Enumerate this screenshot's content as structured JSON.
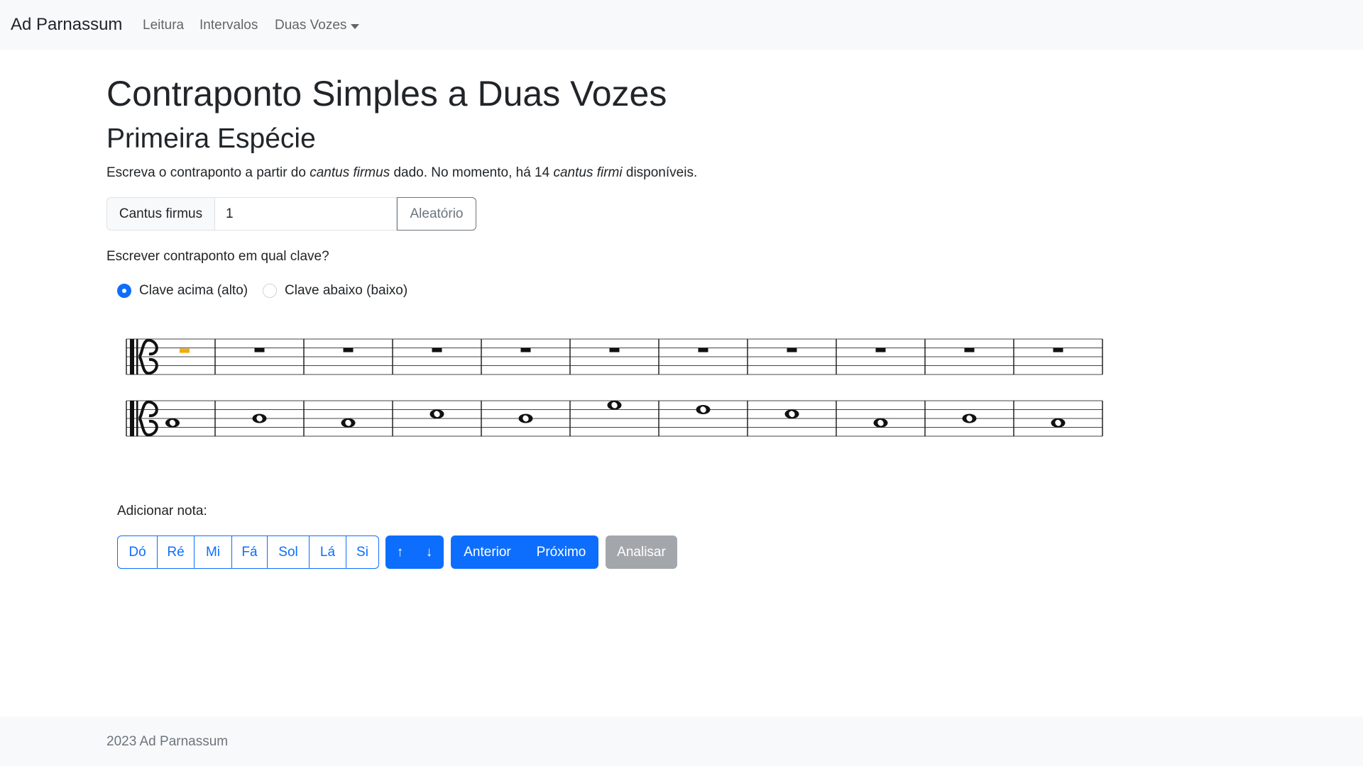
{
  "navbar": {
    "brand": "Ad Parnassum",
    "links": [
      "Leitura",
      "Intervalos",
      "Duas Vozes"
    ]
  },
  "page": {
    "title": "Contraponto Simples a Duas Vozes",
    "subtitle": "Primeira Espécie",
    "intro": {
      "part1": "Escreva o contraponto a partir do ",
      "em1": "cantus firmus",
      "part2": " dado. No momento, há 14 ",
      "em2": "cantus firmi",
      "part3": " disponíveis."
    }
  },
  "cantus_selector": {
    "label": "Cantus firmus",
    "value": "1",
    "random_button": "Aleatório"
  },
  "clef_question": "Escrever contraponto em qual clave?",
  "clef_options": [
    {
      "label": "Clave acima (alto)",
      "checked": true
    },
    {
      "label": "Clave abaixo (baixo)",
      "checked": false
    }
  ],
  "score": {
    "measures": 11,
    "upper_staff": {
      "clef": "alto",
      "content": "rests",
      "cursor_measure": 1,
      "cursor_color": "#f0ad00"
    },
    "lower_staff": {
      "clef": "alto",
      "note_type": "whole",
      "note_steps": [
        -1,
        0,
        -1,
        1,
        0,
        3,
        2,
        1,
        -1,
        0,
        -1
      ]
    }
  },
  "note_input": {
    "label": "Adicionar nota:",
    "notes": [
      "Dó",
      "Ré",
      "Mi",
      "Fá",
      "Sol",
      "Lá",
      "Si"
    ],
    "octave_up": "↑",
    "octave_down": "↓",
    "prev": "Anterior",
    "next": "Próximo",
    "analyze": "Analisar"
  },
  "colors": {
    "primary": "#0d6efd",
    "secondary_disabled": "#a3a7ab",
    "navbar_bg": "#f8f9fa"
  },
  "footer": {
    "text": "2023 Ad Parnassum"
  }
}
